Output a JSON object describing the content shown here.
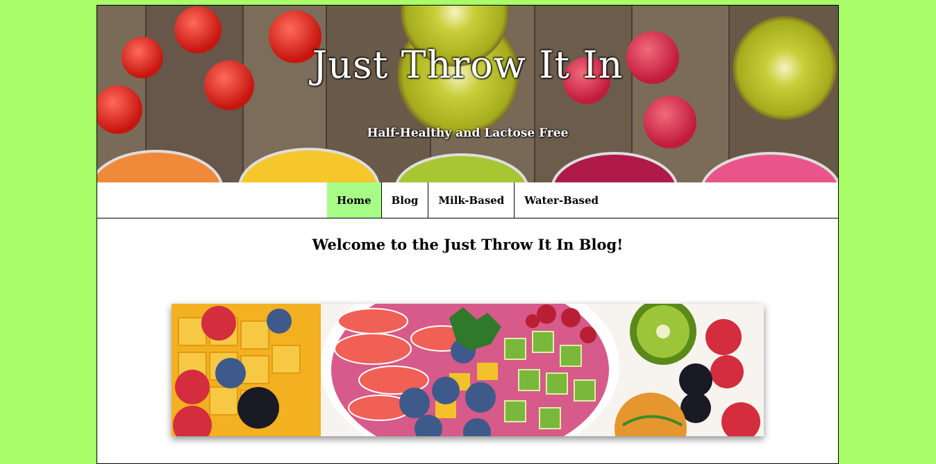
{
  "header": {
    "title": "Just Throw It In",
    "tagline": "Half-Healthy and Lactose Free"
  },
  "nav": {
    "items": [
      {
        "label": "Home",
        "active": true
      },
      {
        "label": "Blog",
        "active": false
      },
      {
        "label": "Milk-Based",
        "active": false
      },
      {
        "label": "Water-Based",
        "active": false
      }
    ]
  },
  "main": {
    "heading": "Welcome to the Just Throw It In Blog!"
  },
  "colors": {
    "page_background": "#a8fd68",
    "nav_active": "#a8fd89"
  }
}
